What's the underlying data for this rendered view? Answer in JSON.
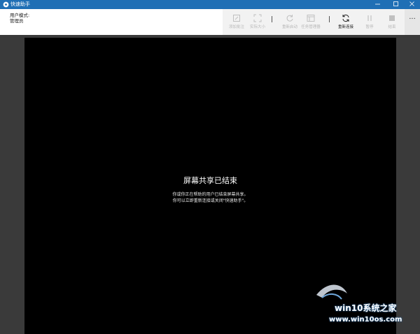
{
  "window": {
    "title": "快速助手"
  },
  "user": {
    "mode_label": "用户模式:",
    "mode_value": "管理员"
  },
  "toolbar": {
    "commands": [
      {
        "label": "添加批注",
        "icon": "annotate-icon",
        "enabled": false
      },
      {
        "label": "实际大小",
        "icon": "actual-size-icon",
        "enabled": false
      },
      {
        "label": "重新启动",
        "icon": "restart-icon",
        "enabled": false
      },
      {
        "label": "任务管理器",
        "icon": "task-manager-icon",
        "enabled": false
      },
      {
        "label": "重新连接",
        "icon": "reconnect-icon",
        "enabled": true
      },
      {
        "label": "暂停",
        "icon": "pause-icon",
        "enabled": false
      },
      {
        "label": "结束",
        "icon": "stop-icon",
        "enabled": false
      }
    ],
    "more_label": "···"
  },
  "screen": {
    "title": "屏幕共享已结束",
    "line1": "你或你正在帮助的用户已结束屏幕共享。",
    "line2": "你可以立即重新连接或关闭\"快速助手\"。"
  },
  "watermark": {
    "brand": "win10系统之家",
    "url": "www.win10os.com"
  },
  "colors": {
    "titlebar": "#1f6fb5",
    "background": "#3a3a3a",
    "viewport": "#000000"
  }
}
